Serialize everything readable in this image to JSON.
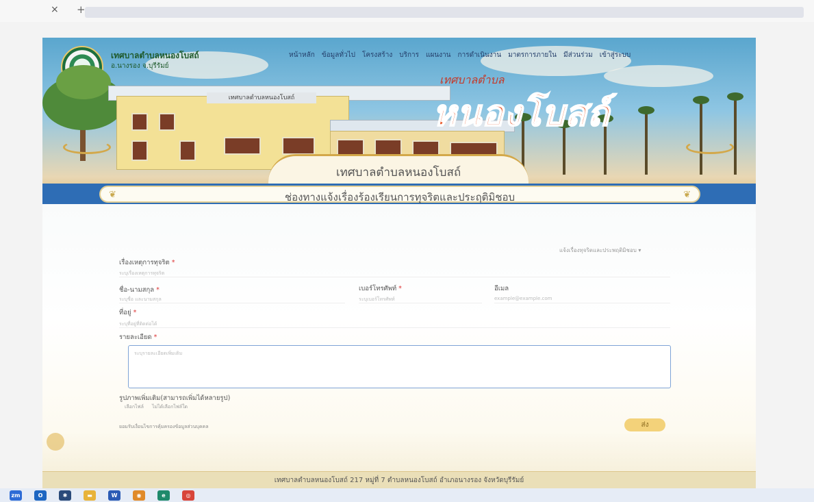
{
  "browser": {
    "tab_close_glyph": "×",
    "new_tab_glyph": "+"
  },
  "site": {
    "name": "เทศบาลตำบลหนองโบสถ์",
    "sub": "อ.นางรอง จ.บุรีรัมย์",
    "nav": [
      "หน้าหลัก",
      "ข้อมูลทั่วไป",
      "โครงสร้าง",
      "บริการ",
      "แผนงาน",
      "การดำเนินงาน",
      "มาตรการภายใน",
      "มีส่วนร่วม",
      "เข้าสู่ระบบ"
    ]
  },
  "hero": {
    "building_sign": "เทศบาลตำบลหนองโบสถ์",
    "title_small": "เทศบาลตำบล",
    "title_big": "หนองโบสถ์",
    "ribbon": "เทศบาลตำบลหนองโบสถ์"
  },
  "notice": {
    "text": "ช่องทางแจ้งเรื่องร้องเรียนการทุจริตและประฤติมิชอบ"
  },
  "form": {
    "category_select": "แจ้งเรื่องทุจริตและประพฤติมิชอบ ▾",
    "subject_label": "เรื่องเหตุการทุจริต",
    "subject_placeholder": "ระบุเรื่องเหตุการทุจริต",
    "name_label": "ชื่อ-นามสกุล",
    "name_placeholder": "ระบุชื่อ และนามสกุล",
    "phone_label": "เบอร์โทรศัพท์",
    "phone_placeholder": "ระบุเบอร์โทรศัพท์",
    "email_label": "อีเมล",
    "email_placeholder": "example@example.com",
    "address_label": "ที่อยู่",
    "address_placeholder": "ระบุที่อยู่ที่ติดต่อได้",
    "detail_label": "รายละเอียด",
    "detail_placeholder": "ระบุรายละเอียดเพิ่มเติม",
    "image_label": "รูปภาพเพิ่มเติม(สามารถเพิ่มได้หลายรูป)",
    "choose_file": "เลือกไฟล์",
    "no_file": "ไม่ได้เลือกไฟล์ใด",
    "consent": "ยอมรับเงื่อนไขการคุ้มครองข้อมูลส่วนบุคคล",
    "required_mark": "*",
    "send": "ส่ง"
  },
  "footer": {
    "text": "เทศบาลตำบลหนองโบสถ์ 217 หมู่ที่ 7 ตำบลหนองโบสถ์ อำเภอนางรอง จังหวัดบุรีรัมย์"
  },
  "taskbar": {
    "items": [
      {
        "name": "zoom-icon",
        "label": "zm",
        "color": "#2d6bd6"
      },
      {
        "name": "outlook-icon",
        "label": "O",
        "color": "#1d66c2"
      },
      {
        "name": "settings-icon",
        "label": "✱",
        "color": "#2a4a7a"
      },
      {
        "name": "file-explorer-icon",
        "label": "▬",
        "color": "#e8b33a"
      },
      {
        "name": "word-icon",
        "label": "W",
        "color": "#2b5bb5"
      },
      {
        "name": "app-icon",
        "label": "◉",
        "color": "#e08a2a"
      },
      {
        "name": "edge-icon",
        "label": "e",
        "color": "#1f8a6b"
      },
      {
        "name": "chrome-icon",
        "label": "◎",
        "color": "#d8453a"
      }
    ]
  }
}
